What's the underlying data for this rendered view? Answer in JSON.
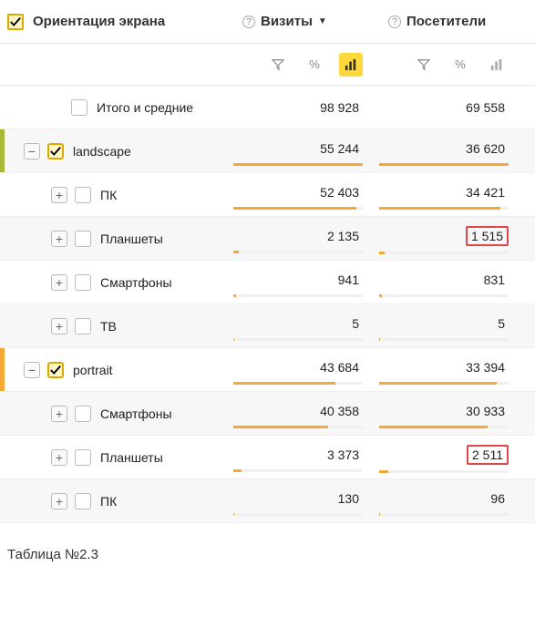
{
  "headers": {
    "dimension": "Ориентация экрана",
    "visits": "Визиты",
    "visitors": "Посетители"
  },
  "tools": {
    "percent": "%"
  },
  "rows": {
    "total": {
      "label": "Итого и средние",
      "visits": "98 928",
      "visitors": "69 558"
    },
    "landscape": {
      "label": "landscape",
      "visits": "55 244",
      "visitors": "36 620"
    },
    "l_pc": {
      "label": "ПК",
      "visits": "52 403",
      "visitors": "34 421"
    },
    "l_tablets": {
      "label": "Планшеты",
      "visits": "2 135",
      "visitors": "1 515"
    },
    "l_phones": {
      "label": "Смартфоны",
      "visits": "941",
      "visitors": "831"
    },
    "l_tv": {
      "label": "ТВ",
      "visits": "5",
      "visitors": "5"
    },
    "portrait": {
      "label": "portrait",
      "visits": "43 684",
      "visitors": "33 394"
    },
    "p_phones": {
      "label": "Смартфоны",
      "visits": "40 358",
      "visitors": "30 933"
    },
    "p_tablets": {
      "label": "Планшеты",
      "visits": "3 373",
      "visitors": "2 511"
    },
    "p_pc": {
      "label": "ПК",
      "visits": "130",
      "visitors": "96"
    }
  },
  "caption": "Таблица №2.3",
  "chart_data": [
    {
      "type": "bar",
      "title": "Визиты",
      "categories": [
        "landscape",
        "landscape/ПК",
        "landscape/Планшеты",
        "landscape/Смартфоны",
        "landscape/ТВ",
        "portrait",
        "portrait/Смартфоны",
        "portrait/Планшеты",
        "portrait/ПК"
      ],
      "values": [
        55244,
        52403,
        2135,
        941,
        5,
        43684,
        40358,
        3373,
        130
      ],
      "total": 98928
    },
    {
      "type": "bar",
      "title": "Посетители",
      "categories": [
        "landscape",
        "landscape/ПК",
        "landscape/Планшеты",
        "landscape/Смартфоны",
        "landscape/ТВ",
        "portrait",
        "portrait/Смартфоны",
        "portrait/Планшеты",
        "portrait/ПК"
      ],
      "values": [
        36620,
        34421,
        1515,
        831,
        5,
        33394,
        30933,
        2511,
        96
      ],
      "total": 69558
    }
  ]
}
